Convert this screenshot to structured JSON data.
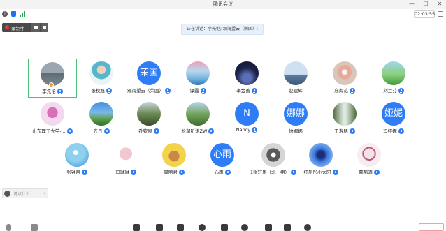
{
  "window": {
    "title": "腾讯会议",
    "minimize": "—",
    "maximize": "☐",
    "close": "✕"
  },
  "toolbar_top": {
    "timer": "02:03:55"
  },
  "recording": {
    "label": "录制中"
  },
  "speaking_banner": "正在讲话：李先伦; 观海望云（荣国）;",
  "participants": [
    {
      "name": "李先伦",
      "avatar_text": "",
      "icon": "lake-photo"
    },
    {
      "name": "张秋旭",
      "avatar_text": "",
      "icon": "girl-photo"
    },
    {
      "name": "观海望云（荣国）",
      "avatar_text": "荣国",
      "icon": ""
    },
    {
      "name": "谭霞",
      "avatar_text": "",
      "icon": "sea-photo"
    },
    {
      "name": "李金善",
      "avatar_text": "",
      "icon": "night-photo"
    },
    {
      "name": "赵建辉",
      "avatar_text": "",
      "icon": "harbor-photo"
    },
    {
      "name": "庙海花",
      "avatar_text": "",
      "icon": "flower-photo"
    },
    {
      "name": "刘兰芬",
      "avatar_text": "",
      "icon": "grass-photo"
    },
    {
      "name": "山东理工大学-...",
      "avatar_text": "",
      "icon": "lotus-photo"
    },
    {
      "name": "齐丹",
      "avatar_text": "",
      "icon": "sky-photo"
    },
    {
      "name": "孙钦泉",
      "avatar_text": "",
      "icon": "forest-photo"
    },
    {
      "name": "松涧听涛ZW",
      "avatar_text": "",
      "icon": "mountain-photo"
    },
    {
      "name": "Nancy",
      "avatar_text": "N",
      "icon": ""
    },
    {
      "name": "徐娜娜",
      "avatar_text": "娜娜",
      "icon": ""
    },
    {
      "name": "王寿朋",
      "avatar_text": "",
      "icon": "waterfall-photo"
    },
    {
      "name": "冯娅妮",
      "avatar_text": "娅妮",
      "icon": ""
    },
    {
      "name": "张钟月",
      "avatar_text": "",
      "icon": "sun-photo"
    },
    {
      "name": "冯琳琳",
      "avatar_text": "",
      "icon": "kids-photo"
    },
    {
      "name": "周丽君",
      "avatar_text": "",
      "icon": "bear-photo"
    },
    {
      "name": "心雨",
      "avatar_text": "心雨",
      "icon": ""
    },
    {
      "name": "1张轩恩（北一组）",
      "avatar_text": "",
      "icon": "star-photo"
    },
    {
      "name": "红彤彤小太阳",
      "avatar_text": "",
      "icon": "blue-photo"
    },
    {
      "name": "葡萄酒",
      "avatar_text": "",
      "icon": "ghost-photo"
    }
  ],
  "chat": {
    "placeholder": "说点什么..."
  }
}
